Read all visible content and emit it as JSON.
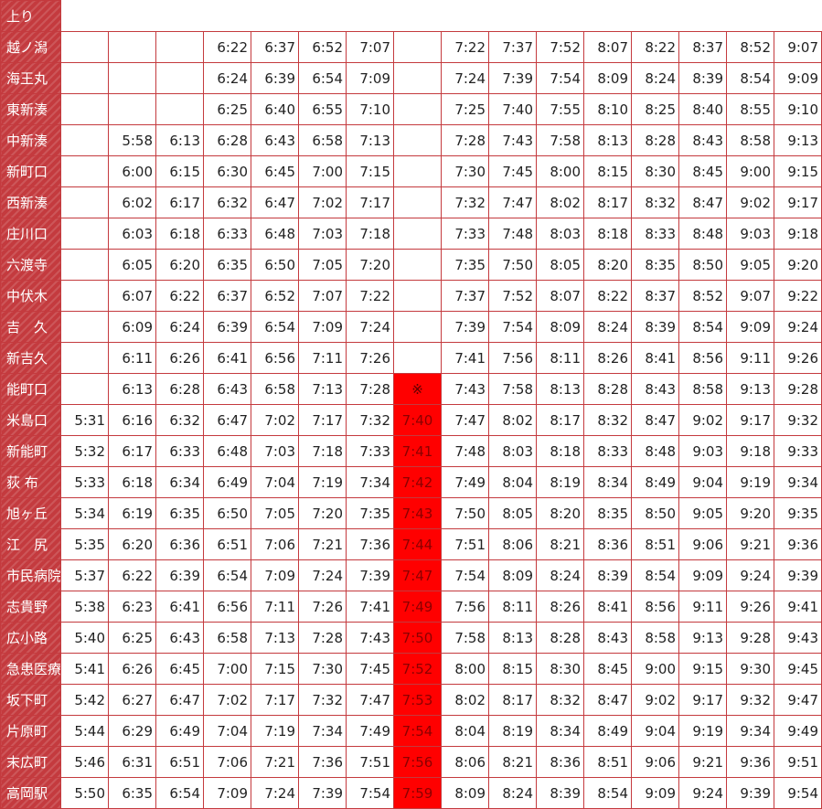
{
  "header": {
    "direction": "上り"
  },
  "timetable": {
    "highlight_column": 7,
    "rows": [
      {
        "station": "越ノ潟",
        "times": [
          "",
          "",
          "",
          "6:22",
          "6:37",
          "6:52",
          "7:07",
          "",
          "7:22",
          "7:37",
          "7:52",
          "8:07",
          "8:22",
          "8:37",
          "8:52",
          "9:07"
        ]
      },
      {
        "station": "海王丸",
        "times": [
          "",
          "",
          "",
          "6:24",
          "6:39",
          "6:54",
          "7:09",
          "",
          "7:24",
          "7:39",
          "7:54",
          "8:09",
          "8:24",
          "8:39",
          "8:54",
          "9:09"
        ]
      },
      {
        "station": "東新湊",
        "times": [
          "",
          "",
          "",
          "6:25",
          "6:40",
          "6:55",
          "7:10",
          "",
          "7:25",
          "7:40",
          "7:55",
          "8:10",
          "8:25",
          "8:40",
          "8:55",
          "9:10"
        ]
      },
      {
        "station": "中新湊",
        "times": [
          "",
          "5:58",
          "6:13",
          "6:28",
          "6:43",
          "6:58",
          "7:13",
          "",
          "7:28",
          "7:43",
          "7:58",
          "8:13",
          "8:28",
          "8:43",
          "8:58",
          "9:13"
        ]
      },
      {
        "station": "新町口",
        "times": [
          "",
          "6:00",
          "6:15",
          "6:30",
          "6:45",
          "7:00",
          "7:15",
          "",
          "7:30",
          "7:45",
          "8:00",
          "8:15",
          "8:30",
          "8:45",
          "9:00",
          "9:15"
        ]
      },
      {
        "station": "西新湊",
        "times": [
          "",
          "6:02",
          "6:17",
          "6:32",
          "6:47",
          "7:02",
          "7:17",
          "",
          "7:32",
          "7:47",
          "8:02",
          "8:17",
          "8:32",
          "8:47",
          "9:02",
          "9:17"
        ]
      },
      {
        "station": "庄川口",
        "times": [
          "",
          "6:03",
          "6:18",
          "6:33",
          "6:48",
          "7:03",
          "7:18",
          "",
          "7:33",
          "7:48",
          "8:03",
          "8:18",
          "8:33",
          "8:48",
          "9:03",
          "9:18"
        ]
      },
      {
        "station": "六渡寺",
        "times": [
          "",
          "6:05",
          "6:20",
          "6:35",
          "6:50",
          "7:05",
          "7:20",
          "",
          "7:35",
          "7:50",
          "8:05",
          "8:20",
          "8:35",
          "8:50",
          "9:05",
          "9:20"
        ]
      },
      {
        "station": "中伏木",
        "times": [
          "",
          "6:07",
          "6:22",
          "6:37",
          "6:52",
          "7:07",
          "7:22",
          "",
          "7:37",
          "7:52",
          "8:07",
          "8:22",
          "8:37",
          "8:52",
          "9:07",
          "9:22"
        ]
      },
      {
        "station": "吉　久",
        "times": [
          "",
          "6:09",
          "6:24",
          "6:39",
          "6:54",
          "7:09",
          "7:24",
          "",
          "7:39",
          "7:54",
          "8:09",
          "8:24",
          "8:39",
          "8:54",
          "9:09",
          "9:24"
        ]
      },
      {
        "station": "新吉久",
        "times": [
          "",
          "6:11",
          "6:26",
          "6:41",
          "6:56",
          "7:11",
          "7:26",
          "",
          "7:41",
          "7:56",
          "8:11",
          "8:26",
          "8:41",
          "8:56",
          "9:11",
          "9:26"
        ]
      },
      {
        "station": "能町口",
        "times": [
          "",
          "6:13",
          "6:28",
          "6:43",
          "6:58",
          "7:13",
          "7:28",
          "※",
          "7:43",
          "7:58",
          "8:13",
          "8:28",
          "8:43",
          "8:58",
          "9:13",
          "9:28"
        ]
      },
      {
        "station": "米島口",
        "times": [
          "5:31",
          "6:16",
          "6:32",
          "6:47",
          "7:02",
          "7:17",
          "7:32",
          "7:40",
          "7:47",
          "8:02",
          "8:17",
          "8:32",
          "8:47",
          "9:02",
          "9:17",
          "9:32"
        ]
      },
      {
        "station": "新能町",
        "times": [
          "5:32",
          "6:17",
          "6:33",
          "6:48",
          "7:03",
          "7:18",
          "7:33",
          "7:41",
          "7:48",
          "8:03",
          "8:18",
          "8:33",
          "8:48",
          "9:03",
          "9:18",
          "9:33"
        ]
      },
      {
        "station": "荻 布",
        "times": [
          "5:33",
          "6:18",
          "6:34",
          "6:49",
          "7:04",
          "7:19",
          "7:34",
          "7:42",
          "7:49",
          "8:04",
          "8:19",
          "8:34",
          "8:49",
          "9:04",
          "9:19",
          "9:34"
        ]
      },
      {
        "station": "旭ヶ丘",
        "times": [
          "5:34",
          "6:19",
          "6:35",
          "6:50",
          "7:05",
          "7:20",
          "7:35",
          "7:43",
          "7:50",
          "8:05",
          "8:20",
          "8:35",
          "8:50",
          "9:05",
          "9:20",
          "9:35"
        ]
      },
      {
        "station": "江　尻",
        "times": [
          "5:35",
          "6:20",
          "6:36",
          "6:51",
          "7:06",
          "7:21",
          "7:36",
          "7:44",
          "7:51",
          "8:06",
          "8:21",
          "8:36",
          "8:51",
          "9:06",
          "9:21",
          "9:36"
        ]
      },
      {
        "station": "市民病院",
        "times": [
          "5:37",
          "6:22",
          "6:39",
          "6:54",
          "7:09",
          "7:24",
          "7:39",
          "7:47",
          "7:54",
          "8:09",
          "8:24",
          "8:39",
          "8:54",
          "9:09",
          "9:24",
          "9:39"
        ]
      },
      {
        "station": "志貴野",
        "times": [
          "5:38",
          "6:23",
          "6:41",
          "6:56",
          "7:11",
          "7:26",
          "7:41",
          "7:49",
          "7:56",
          "8:11",
          "8:26",
          "8:41",
          "8:56",
          "9:11",
          "9:26",
          "9:41"
        ]
      },
      {
        "station": "広小路",
        "times": [
          "5:40",
          "6:25",
          "6:43",
          "6:58",
          "7:13",
          "7:28",
          "7:43",
          "7:50",
          "7:58",
          "8:13",
          "8:28",
          "8:43",
          "8:58",
          "9:13",
          "9:28",
          "9:43"
        ]
      },
      {
        "station": "急患医療",
        "times": [
          "5:41",
          "6:26",
          "6:45",
          "7:00",
          "7:15",
          "7:30",
          "7:45",
          "7:52",
          "8:00",
          "8:15",
          "8:30",
          "8:45",
          "9:00",
          "9:15",
          "9:30",
          "9:45"
        ]
      },
      {
        "station": "坂下町",
        "times": [
          "5:42",
          "6:27",
          "6:47",
          "7:02",
          "7:17",
          "7:32",
          "7:47",
          "7:53",
          "8:02",
          "8:17",
          "8:32",
          "8:47",
          "9:02",
          "9:17",
          "9:32",
          "9:47"
        ]
      },
      {
        "station": "片原町",
        "times": [
          "5:44",
          "6:29",
          "6:49",
          "7:04",
          "7:19",
          "7:34",
          "7:49",
          "7:54",
          "8:04",
          "8:19",
          "8:34",
          "8:49",
          "9:04",
          "9:19",
          "9:34",
          "9:49"
        ]
      },
      {
        "station": "末広町",
        "times": [
          "5:46",
          "6:31",
          "6:51",
          "7:06",
          "7:21",
          "7:36",
          "7:51",
          "7:56",
          "8:06",
          "8:21",
          "8:36",
          "8:51",
          "9:06",
          "9:21",
          "9:36",
          "9:51"
        ]
      },
      {
        "station": "高岡駅",
        "times": [
          "5:50",
          "6:35",
          "6:54",
          "7:09",
          "7:24",
          "7:39",
          "7:54",
          "7:59",
          "8:09",
          "8:24",
          "8:39",
          "8:54",
          "9:09",
          "9:24",
          "9:39",
          "9:54"
        ]
      }
    ]
  },
  "colors": {
    "station_bg": "#c43a3e",
    "border": "#c43a3e",
    "highlight": "#ff0000"
  }
}
